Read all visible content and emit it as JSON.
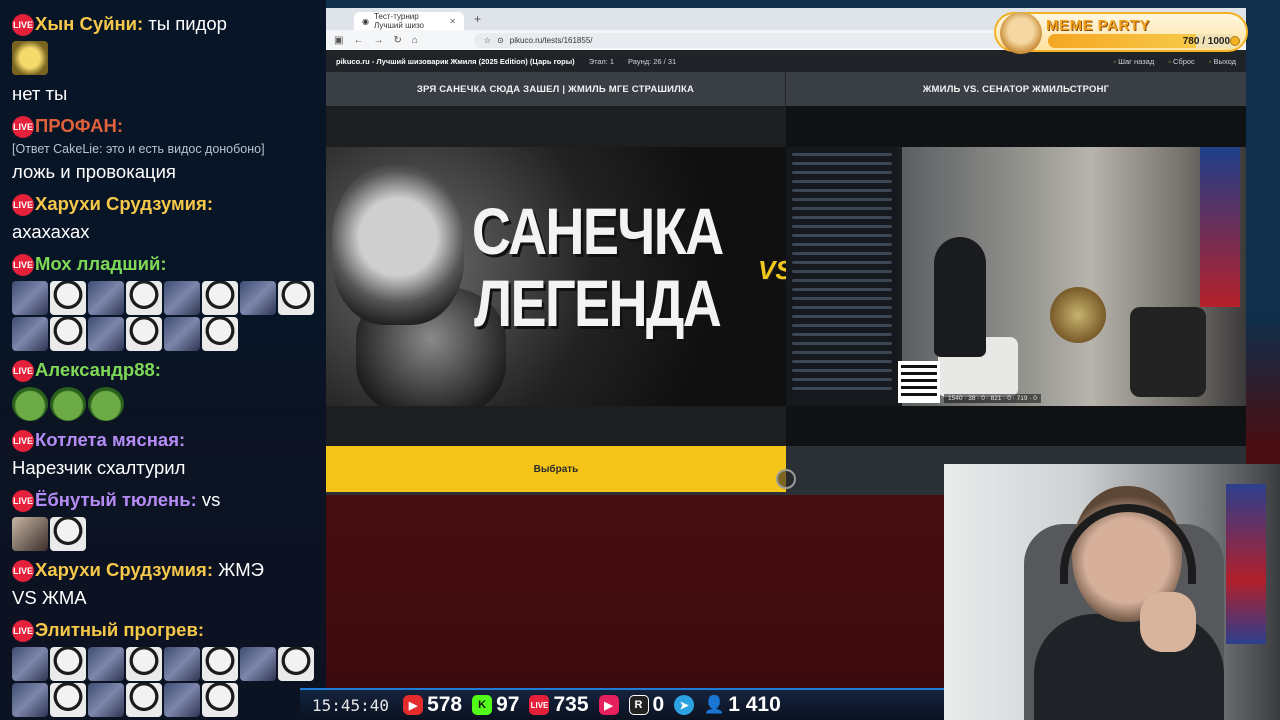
{
  "chat": {
    "messages": [
      {
        "user": "Хын Суйни:",
        "color": "#f5c84a",
        "text": "ты пидор",
        "emotes": [
          "gold"
        ]
      },
      {
        "user": "",
        "color": "#ffffff",
        "text": "нет ты",
        "emotes": []
      },
      {
        "user": "ПРОФАН:",
        "color": "#e0613a",
        "text": "",
        "reply": "[Ответ CakeLie: это и есть видос донобоно]",
        "text2": "ложь и провокация",
        "emotes": []
      },
      {
        "user": "Харухи Срудзумия:",
        "color": "#f5c84a",
        "text": "",
        "text2": "ахахахах",
        "emotes": []
      },
      {
        "user": "Мох лладший:",
        "color": "#7ed957",
        "text": "",
        "emotes": [
          "blur",
          "ghost",
          "blur",
          "ghost",
          "blur",
          "ghost",
          "blur",
          "ghost",
          "blur",
          "ghost",
          "blur",
          "ghost",
          "blur",
          "ghost"
        ]
      },
      {
        "user": "Александр88:",
        "color": "#7ed957",
        "text": "",
        "emotes": [
          "pepe",
          "pepe",
          "pepe"
        ]
      },
      {
        "user": "Котлета мясная:",
        "color": "#b58cf5",
        "text": "",
        "text2": "Нарезчик схалтурил",
        "emotes": []
      },
      {
        "user": "Ёбнутый тюлень:",
        "color": "#b58cf5",
        "text": "vs",
        "emotes": [
          "face",
          "ghost"
        ]
      },
      {
        "user": "Харухи Срудзумия:",
        "color": "#f5c84a",
        "text": "ЖМЭ",
        "text2": "VS ЖМА",
        "emotes": []
      },
      {
        "user": "Элитный прогрев:",
        "color": "#f5c84a",
        "text": "",
        "emotes": [
          "blur",
          "ghost",
          "blur",
          "ghost",
          "blur",
          "ghost",
          "blur",
          "ghost",
          "blur",
          "ghost",
          "blur",
          "ghost",
          "blur",
          "ghost"
        ]
      }
    ],
    "live_label": "LIVE"
  },
  "browser": {
    "tab_title": "Тест-турнир Лучший шизо",
    "url": "pikuco.ru/tests/161855/",
    "site": {
      "title": "pikuco.ru - Лучший шизоварик Жмиля (2025 Edition) (Царь горы)",
      "stage": "Этап: 1",
      "round": "Раунд: 26 / 31",
      "back": "Шаг назад",
      "reset": "Сброс",
      "exit": "Выход"
    },
    "left_title": "ЗРЯ САНЕЧКА СЮДА ЗАШЕЛ | ЖМИЛЬ МГЕ СТРАШИЛКА",
    "right_title": "ЖМИЛЬ VS. СЕНАТОР ЖМИЛЬСТРОНГ",
    "thumb_text_line1": "САНЕЧКА",
    "thumb_text_line2": "ЛЕГЕНДА",
    "vs_badge": "VS",
    "right_stats": "1540 · 38 · 0 · 821 · 0 · 719 · 0",
    "choose_label": "Выбрать"
  },
  "meme_party": {
    "title": "MEME PARTY",
    "current": 780,
    "max": 1000,
    "count_text": "780 / 1000"
  },
  "stats": {
    "time": "15:45:40",
    "youtube": "578",
    "kick": "97",
    "vk": "735",
    "rutube": "0",
    "viewers": "1 410"
  }
}
